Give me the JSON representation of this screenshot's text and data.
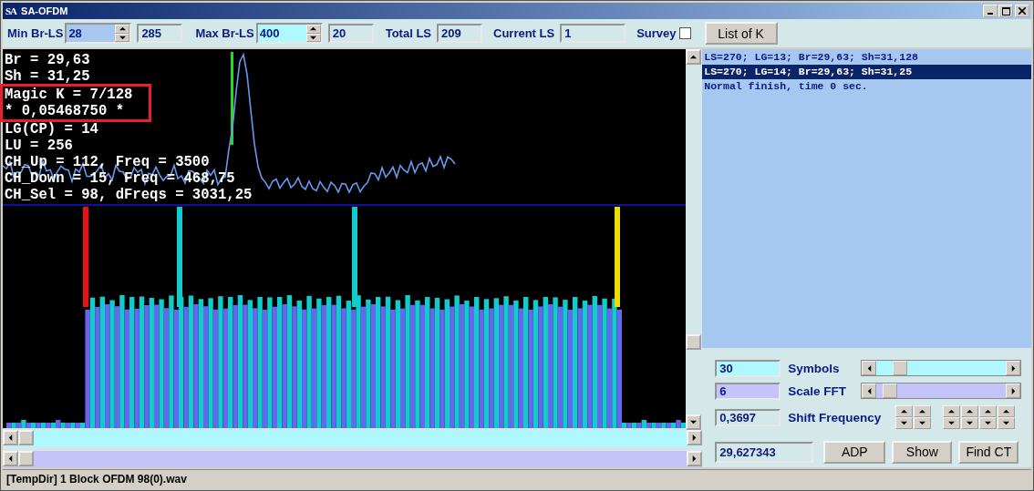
{
  "window": {
    "icon_text": "SA",
    "title": "SA-OFDM"
  },
  "toolbar": {
    "min_br_ls": {
      "label": "Min Br-LS",
      "value": "28",
      "readout": "285"
    },
    "max_br_ls": {
      "label": "Max Br-LS",
      "value": "400",
      "readout": "20"
    },
    "total_ls": {
      "label": "Total LS",
      "value": "209"
    },
    "current_ls": {
      "label": "Current LS",
      "value": "1"
    },
    "survey": {
      "label": "Survey",
      "checked": false
    },
    "list_button": "List of K"
  },
  "plot": {
    "text_lines": [
      {
        "text": "Br = 29,63",
        "boxed": false
      },
      {
        "text": "Sh = 31,25",
        "boxed": false
      },
      {
        "text": "Magic K = 7/128",
        "boxed": true
      },
      {
        "text": "* 0,05468750 *",
        "boxed": true
      },
      {
        "text": "LG(CP) = 14",
        "boxed": false
      },
      {
        "text": "LU = 256",
        "boxed": false
      },
      {
        "text": "CH_Up = 112, Freq = 3500",
        "boxed": false
      },
      {
        "text": "CH_Down = 15, Freq = 468,75",
        "boxed": false
      },
      {
        "text": "CH_Sel = 98, dFreqs = 3031,25",
        "boxed": false
      }
    ]
  },
  "results": {
    "items": [
      {
        "text": "LS=270; LG=13; Br=29,63; Sh=31,128",
        "selected": false
      },
      {
        "text": "LS=270; LG=14; Br=29,63; Sh=31,25",
        "selected": true
      },
      {
        "text": "Normal finish, time 0 sec.",
        "selected": false
      }
    ]
  },
  "controls": {
    "symbols": {
      "value": "30",
      "label": "Symbols",
      "level": 0.14
    },
    "scale_fft": {
      "value": "6",
      "label": "Scale FFT",
      "level": 0.05
    },
    "shift_frequency": {
      "value": "0,3697",
      "label": "Shift Frequency"
    },
    "result": "29,627343",
    "buttons": [
      "ADP",
      "Show",
      "Find CT"
    ]
  },
  "status_bar": "[TempDir] 1 Block OFDM 98(0).wav"
}
